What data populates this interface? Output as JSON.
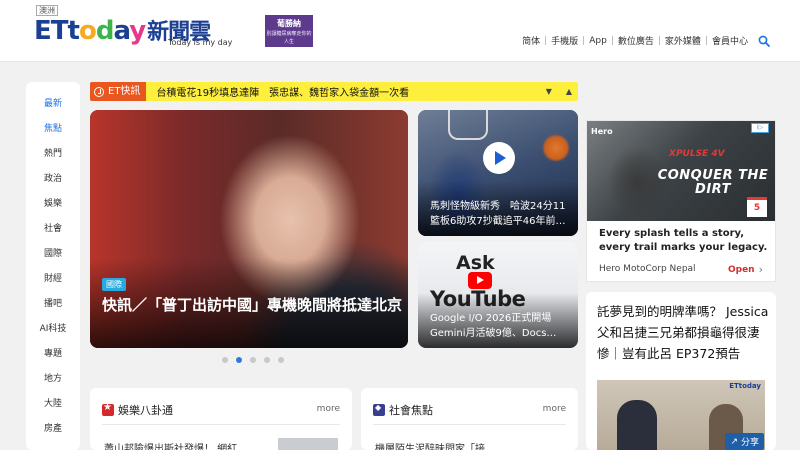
{
  "header": {
    "region_tag": "澳洲",
    "logo": {
      "et": "ET",
      "today_letters": [
        "t",
        "o",
        "d",
        "a",
        "y"
      ],
      "today_colors": [
        "#1b3f93",
        "#f7a91f",
        "#3bb54a",
        "#1b3f93",
        "#e5398b"
      ],
      "brand_cn": "新聞雲",
      "subtitle": "Today is my day"
    },
    "ad": {
      "title": "葡勝納",
      "subtitle": "別讓糖尿病奪走你的人生"
    },
    "nav": [
      "简体",
      "手機版",
      "App",
      "數位廣告",
      "家外媒體",
      "會員中心"
    ],
    "search_icon": "search-icon"
  },
  "sidebar": {
    "items": [
      {
        "label": "最新",
        "active": true
      },
      {
        "label": "焦點",
        "active": true
      },
      {
        "label": "熱門",
        "active": false
      },
      {
        "label": "政治",
        "active": false
      },
      {
        "label": "娛樂",
        "active": false
      },
      {
        "label": "社會",
        "active": false
      },
      {
        "label": "國際",
        "active": false
      },
      {
        "label": "財經",
        "active": false
      },
      {
        "label": "播吧",
        "active": false
      },
      {
        "label": "AI科技",
        "active": false
      },
      {
        "label": "專題",
        "active": false
      },
      {
        "label": "地方",
        "active": false
      },
      {
        "label": "大陸",
        "active": false
      },
      {
        "label": "房產",
        "active": false
      }
    ]
  },
  "flash": {
    "tag": "ET快訊",
    "text": "台積電花19秒填息達陣　張忠謀、魏哲家入袋金額一次看",
    "accent": "#e8571f",
    "bg": "#ffef3d"
  },
  "hero": {
    "category": "國際",
    "title": "快訊／「普丁出訪中國」專機晚間將抵達北京"
  },
  "carousel": {
    "count": 5,
    "active_index": 1
  },
  "cards": [
    {
      "title": "馬刺怪物級新秀　哈波24分11籃板6助攻7抄截追平46年前…"
    },
    {
      "title": "Google I/O 2026正式開場　Gemini月活破9億、Docs…",
      "ask": "Ask",
      "youtube": "YouTube"
    }
  ],
  "ad_right": {
    "brand": "Hero",
    "model": "XPULSE 4V",
    "headline": "CONQUER THE DIRT",
    "choice": "i▷",
    "badge": "5",
    "copy": "Every splash tells a story, every trail marks your legacy.",
    "advertiser": "Hero MotoCorp Nepal",
    "cta": "Open"
  },
  "side_article": {
    "title": "託夢見到的明牌準嗎？ Jessica父和呂捷三兄弟都損龜得很淒慘｜豈有此呂 EP372預告",
    "thumb_tag": "ETtoday",
    "share": "分享"
  },
  "boxes": {
    "entertainment": {
      "title": "娛樂八卦通",
      "more": "more",
      "peek": "蕭山邦險爆出斯社發爆！ 網紅"
    },
    "society": {
      "title": "社會焦點",
      "more": "more",
      "peek": "機層陌生泥醉昧問家「接"
    }
  }
}
